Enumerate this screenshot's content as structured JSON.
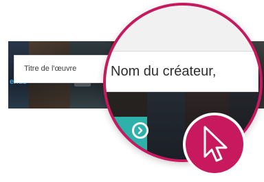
{
  "search": {
    "title_placeholder": "Titre de l'œuvre",
    "creator_placeholder_zoomed": "Nom du créateur,"
  },
  "strip": {
    "badge_text": "erius"
  },
  "colors": {
    "accent_magenta": "#c9195e",
    "button_teal": "#2fb1ab",
    "dark_tiles": "#1e2126"
  },
  "icons": {
    "go_button": "arrow-circle-right-icon",
    "cursor": "mouse-pointer-icon"
  }
}
